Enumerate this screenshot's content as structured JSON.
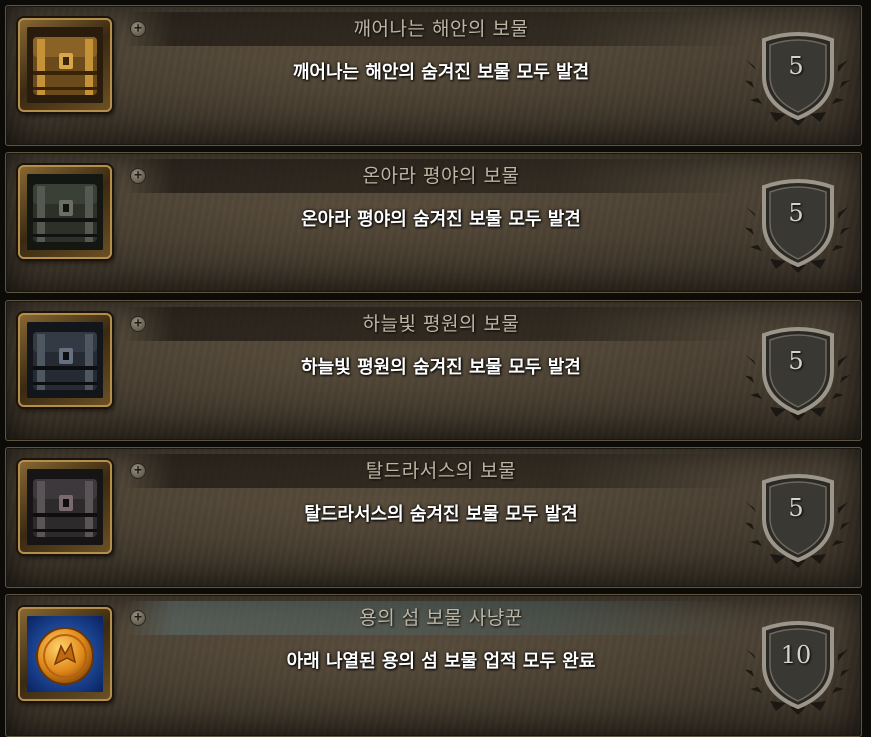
{
  "achievements": [
    {
      "title": "깨어나는 해안의 보물",
      "description": "깨어나는 해안의 숨겨진 보물 모두 발견",
      "points": "5",
      "icon": "treasure-chest-icon"
    },
    {
      "title": "온아라 평야의 보물",
      "description": "온아라 평야의 숨겨진 보물 모두 발견",
      "points": "5",
      "icon": "treasure-chest-icon"
    },
    {
      "title": "하늘빛 평원의 보물",
      "description": "하늘빛 평원의 숨겨진 보물 모두 발견",
      "points": "5",
      "icon": "treasure-chest-icon"
    },
    {
      "title": "탈드라서스의 보물",
      "description": "탈드라서스의 숨겨진 보물 모두 발견",
      "points": "5",
      "icon": "treasure-chest-icon"
    },
    {
      "title": "용의 섬 보물 사냥꾼",
      "description": "아래 나열된 용의 섬 보물 업적 모두 완료",
      "points": "10",
      "icon": "gold-coin-icon"
    }
  ],
  "colors": {
    "title_text": "#bcb5a3",
    "description_text": "#ffffff",
    "panel_border": "#5e5540"
  }
}
